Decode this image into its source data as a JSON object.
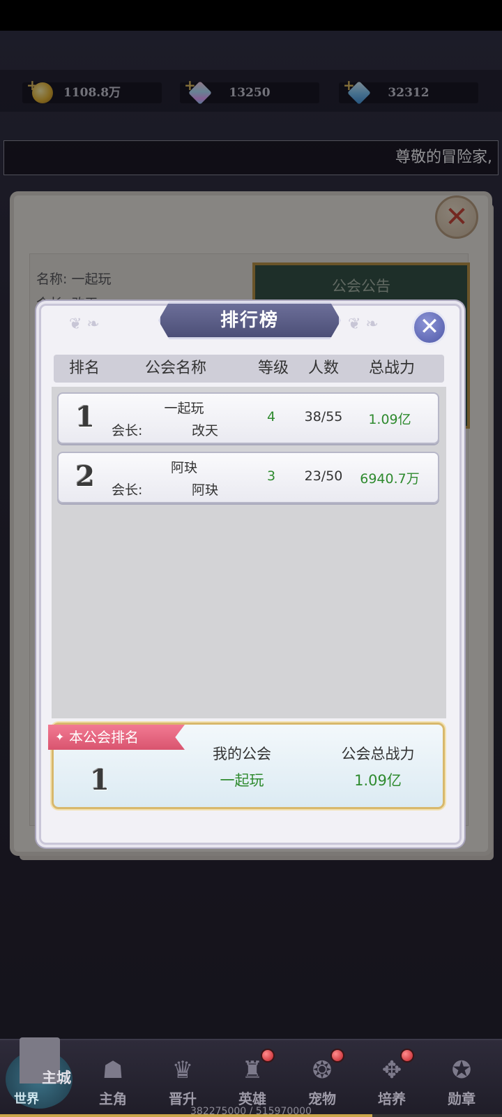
{
  "resources": [
    {
      "icon": "gold-coin-icon",
      "value": "1108.8万"
    },
    {
      "icon": "rainbow-gem-icon",
      "value": "13250"
    },
    {
      "icon": "blue-diamond-icon",
      "value": "32312"
    }
  ],
  "marquee": "尊敬的冒险家,",
  "guild_panel": {
    "name_line": "名称:  一起玩",
    "leader_line": "会长:  改天",
    "notice_title": "公会公告"
  },
  "ranking_modal": {
    "title": "排行榜",
    "columns": {
      "rank": "排名",
      "guild_name": "公会名称",
      "level": "等级",
      "members": "人数",
      "total_power": "总战力"
    },
    "rows": [
      {
        "rank": "1",
        "guild_name": "一起玩",
        "leader_label": "会长:",
        "leader": "改天",
        "level": "4",
        "members": "38/55",
        "power": "1.09亿"
      },
      {
        "rank": "2",
        "guild_name": "阿玦",
        "leader_label": "会长:",
        "leader": "阿玦",
        "level": "3",
        "members": "23/50",
        "power": "6940.7万"
      }
    ],
    "my_guild": {
      "ribbon_label": "本公会排名",
      "rank": "1",
      "name_header": "我的公会",
      "power_header": "公会总战力",
      "name": "一起玩",
      "power": "1.09亿"
    }
  },
  "bottom_nav": {
    "city": {
      "main_label": "主城",
      "world_label": "世界"
    },
    "items": [
      {
        "label": "主角",
        "badge": false
      },
      {
        "label": "晋升",
        "badge": false
      },
      {
        "label": "英雄",
        "badge": true
      },
      {
        "label": "宠物",
        "badge": true
      },
      {
        "label": "培养",
        "badge": true
      },
      {
        "label": "勋章",
        "badge": false
      }
    ]
  },
  "progress": {
    "text": "382275000 / 515970000",
    "fraction": 0.741
  }
}
